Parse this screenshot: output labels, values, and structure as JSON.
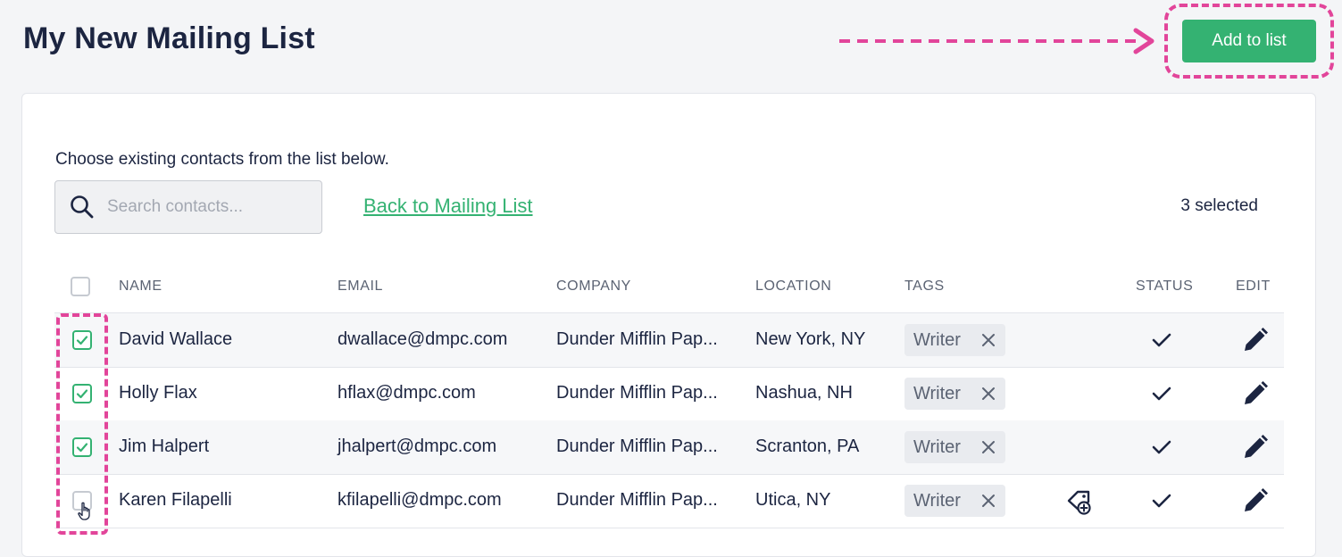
{
  "header": {
    "title": "My New Mailing List",
    "add_button_label": "Add to list"
  },
  "toolbar": {
    "instructions": "Choose existing contacts from the list below.",
    "search_placeholder": "Search contacts...",
    "back_link": "Back to Mailing List",
    "selected_count": "3 selected"
  },
  "table": {
    "headers": {
      "name": "NAME",
      "email": "EMAIL",
      "company": "COMPANY",
      "location": "LOCATION",
      "tags": "TAGS",
      "status": "STATUS",
      "edit": "EDIT"
    },
    "rows": [
      {
        "name": "David Wallace",
        "email": "dwallace@dmpc.com",
        "company": "Dunder Mifflin Pap...",
        "location": "New York, NY",
        "tag": "Writer",
        "checked": true
      },
      {
        "name": "Holly Flax",
        "email": "hflax@dmpc.com",
        "company": "Dunder Mifflin Pap...",
        "location": "Nashua, NH",
        "tag": "Writer",
        "checked": true
      },
      {
        "name": "Jim Halpert",
        "email": "jhalpert@dmpc.com",
        "company": "Dunder Mifflin Pap...",
        "location": "Scranton, PA",
        "tag": "Writer",
        "checked": true
      },
      {
        "name": "Karen Filapelli",
        "email": "kfilapelli@dmpc.com",
        "company": "Dunder Mifflin Pap...",
        "location": "Utica, NY",
        "tag": "Writer",
        "checked": false
      }
    ]
  },
  "icons": {
    "search": "search-icon",
    "tag_remove": "close-icon",
    "status": "check-icon",
    "edit": "pencil-icon",
    "add_tag": "tag-add-icon",
    "cursor": "hand-pointer-icon"
  },
  "colors": {
    "accent_green": "#34b272",
    "annotation_pink": "#e2459a",
    "title_navy": "#1c2541"
  }
}
